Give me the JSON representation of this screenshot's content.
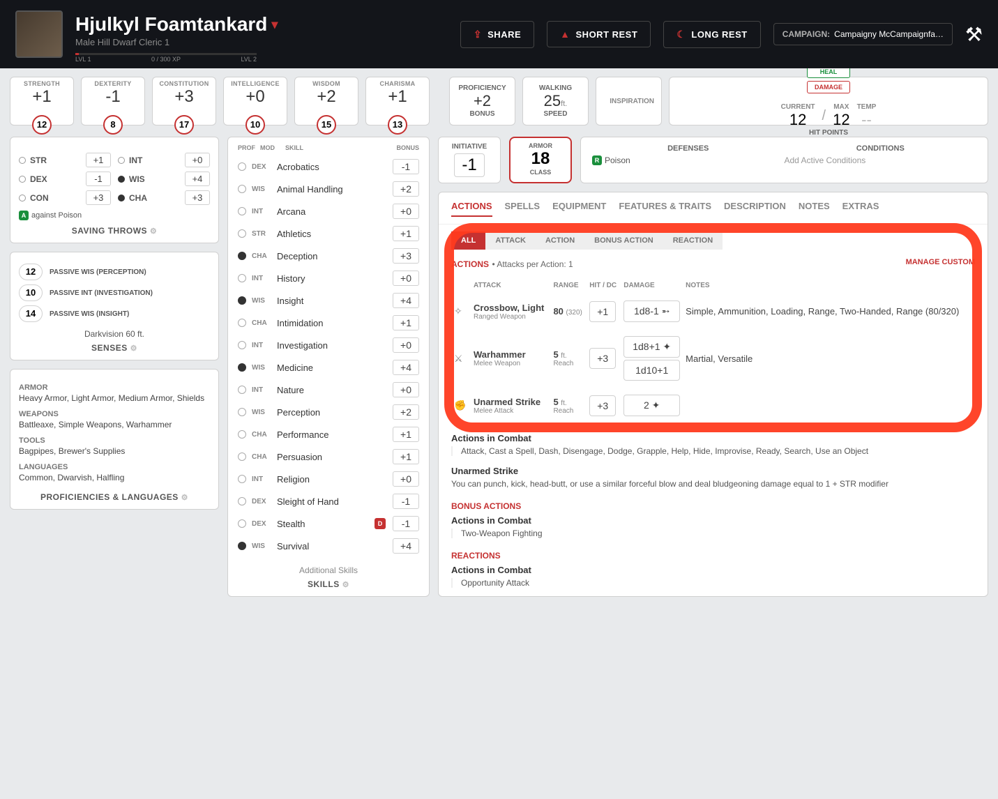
{
  "header": {
    "name": "Hjulkyl Foamtankard",
    "sub": "Male  Hill Dwarf  Cleric 1",
    "lvl_left": "LVL 1",
    "lvl_right": "LVL 2",
    "xp": "0 / 300 XP",
    "share": "SHARE",
    "short_rest": "SHORT REST",
    "long_rest": "LONG REST",
    "campaign_lbl": "CAMPAIGN:",
    "campaign_val": "Campaigny McCampaignfa…"
  },
  "abilities": [
    {
      "name": "STRENGTH",
      "mod": "+1",
      "score": "12"
    },
    {
      "name": "DEXTERITY",
      "mod": "-1",
      "score": "8"
    },
    {
      "name": "CONSTITUTION",
      "mod": "+3",
      "score": "17"
    },
    {
      "name": "INTELLIGENCE",
      "mod": "+0",
      "score": "10"
    },
    {
      "name": "WISDOM",
      "mod": "+2",
      "score": "15"
    },
    {
      "name": "CHARISMA",
      "mod": "+1",
      "score": "13"
    }
  ],
  "prof": {
    "lbl": "PROFICIENCY",
    "val": "+2",
    "sub": "BONUS"
  },
  "speed": {
    "lbl": "WALKING",
    "val": "25",
    "unit": "ft.",
    "sub": "SPEED"
  },
  "insp": "INSPIRATION",
  "hp": {
    "heal": "HEAL",
    "dmg": "DAMAGE",
    "cur_lbl": "CURRENT",
    "cur": "12",
    "max_lbl": "MAX",
    "max": "12",
    "tmp_lbl": "TEMP",
    "tmp": "--",
    "sub": "HIT POINTS"
  },
  "saves": {
    "rows": [
      {
        "nm": "STR",
        "bn": "+1",
        "prof": false
      },
      {
        "nm": "INT",
        "bn": "+0",
        "prof": false
      },
      {
        "nm": "DEX",
        "bn": "-1",
        "prof": false
      },
      {
        "nm": "WIS",
        "bn": "+4",
        "prof": true
      },
      {
        "nm": "CON",
        "bn": "+3",
        "prof": false
      },
      {
        "nm": "CHA",
        "bn": "+3",
        "prof": true
      }
    ],
    "adv": "against Poison",
    "title": "SAVING THROWS"
  },
  "senses": {
    "rows": [
      {
        "v": "12",
        "t": "PASSIVE WIS (PERCEPTION)"
      },
      {
        "v": "10",
        "t": "PASSIVE INT (INVESTIGATION)"
      },
      {
        "v": "14",
        "t": "PASSIVE WIS (INSIGHT)"
      }
    ],
    "extra": "Darkvision 60 ft.",
    "title": "SENSES"
  },
  "profs": {
    "armor_h": "ARMOR",
    "armor": "Heavy Armor, Light Armor, Medium Armor, Shields",
    "wep_h": "WEAPONS",
    "wep": "Battleaxe, Simple Weapons, Warhammer",
    "tool_h": "TOOLS",
    "tool": "Bagpipes, Brewer's Supplies",
    "lang_h": "LANGUAGES",
    "lang": "Common, Dwarvish, Halfling",
    "title": "PROFICIENCIES & LANGUAGES"
  },
  "skills": {
    "hdr": {
      "c1": "PROF",
      "c2": "MOD",
      "c3": "SKILL",
      "c4": "BONUS"
    },
    "rows": [
      {
        "p": false,
        "ab": "DEX",
        "nm": "Acrobatics",
        "bn": "-1"
      },
      {
        "p": false,
        "ab": "WIS",
        "nm": "Animal Handling",
        "bn": "+2"
      },
      {
        "p": false,
        "ab": "INT",
        "nm": "Arcana",
        "bn": "+0"
      },
      {
        "p": false,
        "ab": "STR",
        "nm": "Athletics",
        "bn": "+1"
      },
      {
        "p": true,
        "ab": "CHA",
        "nm": "Deception",
        "bn": "+3"
      },
      {
        "p": false,
        "ab": "INT",
        "nm": "History",
        "bn": "+0"
      },
      {
        "p": true,
        "ab": "WIS",
        "nm": "Insight",
        "bn": "+4"
      },
      {
        "p": false,
        "ab": "CHA",
        "nm": "Intimidation",
        "bn": "+1"
      },
      {
        "p": false,
        "ab": "INT",
        "nm": "Investigation",
        "bn": "+0"
      },
      {
        "p": true,
        "ab": "WIS",
        "nm": "Medicine",
        "bn": "+4"
      },
      {
        "p": false,
        "ab": "INT",
        "nm": "Nature",
        "bn": "+0"
      },
      {
        "p": false,
        "ab": "WIS",
        "nm": "Perception",
        "bn": "+2"
      },
      {
        "p": false,
        "ab": "CHA",
        "nm": "Performance",
        "bn": "+1"
      },
      {
        "p": false,
        "ab": "CHA",
        "nm": "Persuasion",
        "bn": "+1"
      },
      {
        "p": false,
        "ab": "INT",
        "nm": "Religion",
        "bn": "+0"
      },
      {
        "p": false,
        "ab": "DEX",
        "nm": "Sleight of Hand",
        "bn": "-1"
      },
      {
        "p": false,
        "ab": "DEX",
        "nm": "Stealth",
        "bn": "-1",
        "dis": true
      },
      {
        "p": true,
        "ab": "WIS",
        "nm": "Survival",
        "bn": "+4"
      }
    ],
    "addl": "Additional Skills",
    "title": "SKILLS"
  },
  "init": {
    "lbl": "INITIATIVE",
    "val": "-1"
  },
  "ac": {
    "t1": "ARMOR",
    "v": "18",
    "t2": "CLASS"
  },
  "def": {
    "h": "DEFENSES",
    "b": "Poison"
  },
  "cond": {
    "h": "CONDITIONS",
    "b": "Add Active Conditions"
  },
  "tabs": [
    "ACTIONS",
    "SPELLS",
    "EQUIPMENT",
    "FEATURES & TRAITS",
    "DESCRIPTION",
    "NOTES",
    "EXTRAS"
  ],
  "subtabs": [
    "ALL",
    "ATTACK",
    "ACTION",
    "BONUS ACTION",
    "REACTION"
  ],
  "actions": {
    "lbl": "ACTIONS",
    "apA": " • Attacks per Action: 1",
    "manage": "MANAGE CUSTOM",
    "th": {
      "atk": "ATTACK",
      "rng": "RANGE",
      "hit": "HIT / DC",
      "dmg": "DAMAGE",
      "notes": "NOTES"
    },
    "rows": [
      {
        "ico": "✧",
        "nm": "Crossbow, Light",
        "sub": "Ranged Weapon",
        "rng": "80",
        "rng2": "(320)",
        "hit": "+1",
        "dmg": [
          "1d8-1 ➵"
        ],
        "notes": "Simple, Ammunition, Loading, Range, Two-Handed, Range (80/320)"
      },
      {
        "ico": "⚔",
        "nm": "Warhammer",
        "sub": "Melee Weapon",
        "rng": "5",
        "rngu": "ft.",
        "rng3": "Reach",
        "hit": "+3",
        "dmg": [
          "1d8+1 ✦",
          "1d10+1"
        ],
        "notes": "Martial, Versatile"
      },
      {
        "ico": "✊",
        "nm": "Unarmed Strike",
        "sub": "Melee Attack",
        "rng": "5",
        "rngu": "ft.",
        "rng3": "Reach",
        "hit": "+3",
        "dmg": [
          "2 ✦"
        ],
        "notes": ""
      }
    ],
    "combat_h": "Actions in Combat",
    "combat_list": "Attack, Cast a Spell, Dash, Disengage, Dodge, Grapple, Help, Hide, Improvise, Ready, Search, Use an Object",
    "us_h": "Unarmed Strike",
    "us_b": "You can punch, kick, head-butt, or use a similar forceful blow and deal bludgeoning damage equal to 1 + STR modifier",
    "ba_lbl": "BONUS ACTIONS",
    "ba_h": "Actions in Combat",
    "ba_b": "Two-Weapon Fighting",
    "re_lbl": "REACTIONS",
    "re_h": "Actions in Combat",
    "re_b": "Opportunity Attack"
  }
}
